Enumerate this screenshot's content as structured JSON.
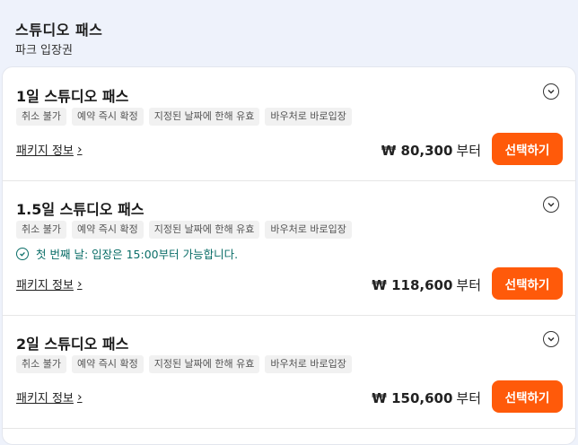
{
  "header": {
    "title": "스튜디오 패스",
    "subtitle": "파크 입장권"
  },
  "cards": [
    {
      "title": "1일 스튜디오 패스",
      "tags": [
        "취소 불가",
        "예약 즉시 확정",
        "지정된 날짜에 한해 유효",
        "바우처로 바로입장"
      ],
      "package_link": "패키지 정보",
      "price": "₩ 80,300",
      "price_suffix": "부터",
      "button": "선택하기"
    },
    {
      "title": "1.5일 스튜디오 패스",
      "tags": [
        "취소 불가",
        "예약 즉시 확정",
        "지정된 날짜에 한해 유효",
        "바우처로 바로입장"
      ],
      "notice": "첫 번째 날: 입장은 15:00부터 가능합니다.",
      "package_link": "패키지 정보",
      "price": "₩ 118,600",
      "price_suffix": "부터",
      "button": "선택하기"
    },
    {
      "title": "2일 스튜디오 패스",
      "tags": [
        "취소 불가",
        "예약 즉시 확정",
        "지정된 날짜에 한해 유효",
        "바우처로 바로입장"
      ],
      "package_link": "패키지 정보",
      "price": "₩ 150,600",
      "price_suffix": "부터",
      "button": "선택하기"
    }
  ],
  "icons": {
    "expand": "chevron-down-icon",
    "notice": "check-circle-icon",
    "link": "chevron-right-icon"
  },
  "colors": {
    "accent": "#ff5a0a",
    "notice": "#0b6e68"
  }
}
